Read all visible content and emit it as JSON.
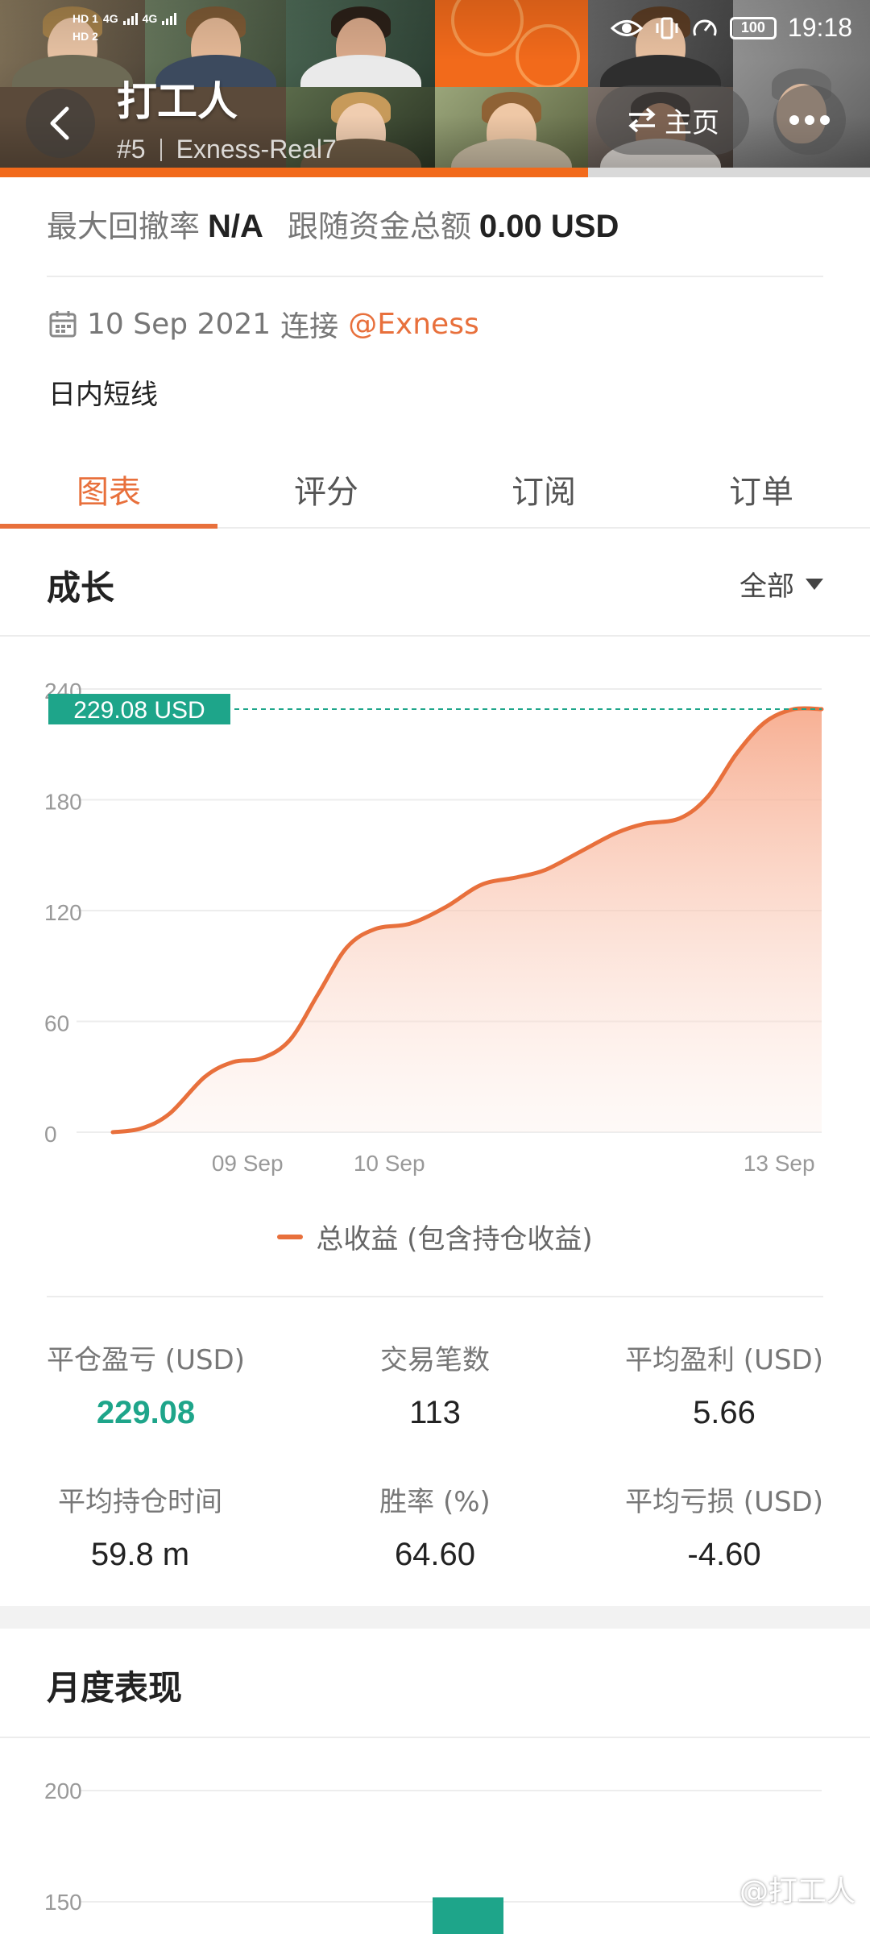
{
  "status_bar": {
    "time": "19:18",
    "battery": "100",
    "hd1": "HD 1",
    "hd2": "HD 2",
    "net1": "4G",
    "net2": "4G"
  },
  "header": {
    "title": "打工人",
    "rank": "#5",
    "account": "Exness-Real7",
    "home_label": "主页"
  },
  "info": {
    "drawdown_label": "最大回撤率",
    "drawdown_value": "N/A",
    "funds_label": "跟随资金总额",
    "funds_value": "0.00 USD",
    "connected_date": "10 Sep 2021",
    "connected_label": "连接",
    "broker": "@Exness",
    "description": "日内短线"
  },
  "tabs": [
    {
      "label": "图表",
      "active": true
    },
    {
      "label": "评分",
      "active": false
    },
    {
      "label": "订阅",
      "active": false
    },
    {
      "label": "订单",
      "active": false
    }
  ],
  "growth": {
    "title": "成长",
    "filter": "全部"
  },
  "chart_data": {
    "type": "area",
    "title": "",
    "ylim": [
      0,
      240
    ],
    "yticks": [
      0,
      60,
      120,
      180,
      240
    ],
    "xticks": [
      {
        "label": "09 Sep",
        "x": 0.19
      },
      {
        "label": "10 Sep",
        "x": 0.39
      },
      {
        "label": "13 Sep",
        "x": 0.94
      }
    ],
    "series": [
      {
        "name": "总收益 (包含持仓收益)",
        "points": [
          [
            0.0,
            0
          ],
          [
            0.04,
            2
          ],
          [
            0.08,
            10
          ],
          [
            0.13,
            30
          ],
          [
            0.17,
            38
          ],
          [
            0.21,
            40
          ],
          [
            0.25,
            50
          ],
          [
            0.29,
            75
          ],
          [
            0.33,
            100
          ],
          [
            0.37,
            110
          ],
          [
            0.42,
            113
          ],
          [
            0.47,
            122
          ],
          [
            0.52,
            134
          ],
          [
            0.57,
            138
          ],
          [
            0.61,
            142
          ],
          [
            0.66,
            152
          ],
          [
            0.71,
            162
          ],
          [
            0.75,
            167
          ],
          [
            0.8,
            170
          ],
          [
            0.84,
            182
          ],
          [
            0.88,
            205
          ],
          [
            0.92,
            222
          ],
          [
            0.96,
            229
          ],
          [
            1.0,
            229.08
          ]
        ]
      }
    ],
    "last_value_label": "229.08 USD",
    "colors": {
      "line": "#e8703c",
      "fill": "#f9b49a",
      "marker": "#1ea58a"
    }
  },
  "stats": [
    {
      "label": "平仓盈亏 (USD)",
      "value": "229.08",
      "green": true
    },
    {
      "label": "交易笔数",
      "value": "113",
      "green": false
    },
    {
      "label": "平均盈利 (USD)",
      "value": "5.66",
      "green": false
    },
    {
      "label": "平均持仓时间",
      "value": "59.8 m",
      "green": false
    },
    {
      "label": "胜率 (%)",
      "value": "64.60",
      "green": false
    },
    {
      "label": "平均亏损 (USD)",
      "value": "-4.60",
      "green": false
    }
  ],
  "monthly": {
    "title": "月度表现",
    "chart_data": {
      "type": "bar",
      "yticks": [
        150,
        200
      ],
      "bars": [
        {
          "category": "",
          "value": 152
        }
      ],
      "colors": {
        "bar": "#1ea58a"
      }
    }
  },
  "watermark": "@打工人"
}
